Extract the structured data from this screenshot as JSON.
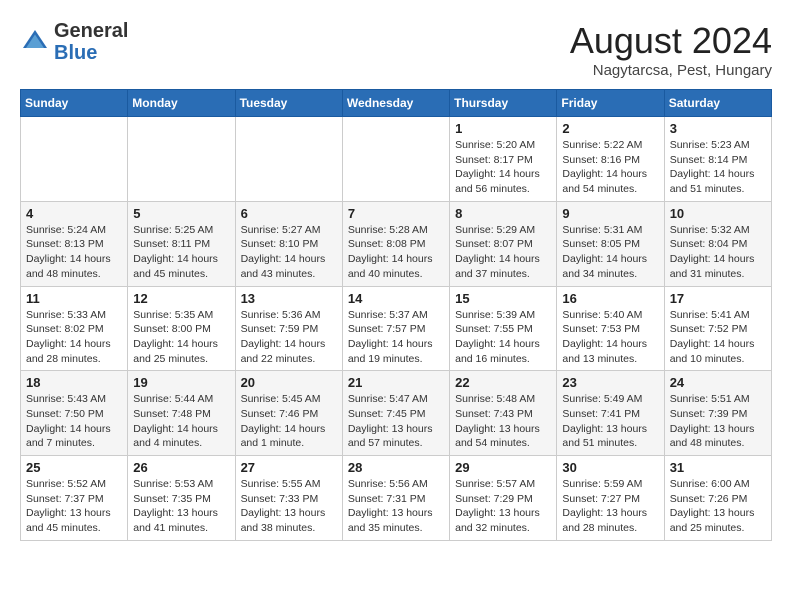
{
  "header": {
    "logo_general": "General",
    "logo_blue": "Blue",
    "month_title": "August 2024",
    "location": "Nagytarcsa, Pest, Hungary"
  },
  "weekdays": [
    "Sunday",
    "Monday",
    "Tuesday",
    "Wednesday",
    "Thursday",
    "Friday",
    "Saturday"
  ],
  "weeks": [
    [
      {
        "day": "",
        "info": ""
      },
      {
        "day": "",
        "info": ""
      },
      {
        "day": "",
        "info": ""
      },
      {
        "day": "",
        "info": ""
      },
      {
        "day": "1",
        "info": "Sunrise: 5:20 AM\nSunset: 8:17 PM\nDaylight: 14 hours\nand 56 minutes."
      },
      {
        "day": "2",
        "info": "Sunrise: 5:22 AM\nSunset: 8:16 PM\nDaylight: 14 hours\nand 54 minutes."
      },
      {
        "day": "3",
        "info": "Sunrise: 5:23 AM\nSunset: 8:14 PM\nDaylight: 14 hours\nand 51 minutes."
      }
    ],
    [
      {
        "day": "4",
        "info": "Sunrise: 5:24 AM\nSunset: 8:13 PM\nDaylight: 14 hours\nand 48 minutes."
      },
      {
        "day": "5",
        "info": "Sunrise: 5:25 AM\nSunset: 8:11 PM\nDaylight: 14 hours\nand 45 minutes."
      },
      {
        "day": "6",
        "info": "Sunrise: 5:27 AM\nSunset: 8:10 PM\nDaylight: 14 hours\nand 43 minutes."
      },
      {
        "day": "7",
        "info": "Sunrise: 5:28 AM\nSunset: 8:08 PM\nDaylight: 14 hours\nand 40 minutes."
      },
      {
        "day": "8",
        "info": "Sunrise: 5:29 AM\nSunset: 8:07 PM\nDaylight: 14 hours\nand 37 minutes."
      },
      {
        "day": "9",
        "info": "Sunrise: 5:31 AM\nSunset: 8:05 PM\nDaylight: 14 hours\nand 34 minutes."
      },
      {
        "day": "10",
        "info": "Sunrise: 5:32 AM\nSunset: 8:04 PM\nDaylight: 14 hours\nand 31 minutes."
      }
    ],
    [
      {
        "day": "11",
        "info": "Sunrise: 5:33 AM\nSunset: 8:02 PM\nDaylight: 14 hours\nand 28 minutes."
      },
      {
        "day": "12",
        "info": "Sunrise: 5:35 AM\nSunset: 8:00 PM\nDaylight: 14 hours\nand 25 minutes."
      },
      {
        "day": "13",
        "info": "Sunrise: 5:36 AM\nSunset: 7:59 PM\nDaylight: 14 hours\nand 22 minutes."
      },
      {
        "day": "14",
        "info": "Sunrise: 5:37 AM\nSunset: 7:57 PM\nDaylight: 14 hours\nand 19 minutes."
      },
      {
        "day": "15",
        "info": "Sunrise: 5:39 AM\nSunset: 7:55 PM\nDaylight: 14 hours\nand 16 minutes."
      },
      {
        "day": "16",
        "info": "Sunrise: 5:40 AM\nSunset: 7:53 PM\nDaylight: 14 hours\nand 13 minutes."
      },
      {
        "day": "17",
        "info": "Sunrise: 5:41 AM\nSunset: 7:52 PM\nDaylight: 14 hours\nand 10 minutes."
      }
    ],
    [
      {
        "day": "18",
        "info": "Sunrise: 5:43 AM\nSunset: 7:50 PM\nDaylight: 14 hours\nand 7 minutes."
      },
      {
        "day": "19",
        "info": "Sunrise: 5:44 AM\nSunset: 7:48 PM\nDaylight: 14 hours\nand 4 minutes."
      },
      {
        "day": "20",
        "info": "Sunrise: 5:45 AM\nSunset: 7:46 PM\nDaylight: 14 hours\nand 1 minute."
      },
      {
        "day": "21",
        "info": "Sunrise: 5:47 AM\nSunset: 7:45 PM\nDaylight: 13 hours\nand 57 minutes."
      },
      {
        "day": "22",
        "info": "Sunrise: 5:48 AM\nSunset: 7:43 PM\nDaylight: 13 hours\nand 54 minutes."
      },
      {
        "day": "23",
        "info": "Sunrise: 5:49 AM\nSunset: 7:41 PM\nDaylight: 13 hours\nand 51 minutes."
      },
      {
        "day": "24",
        "info": "Sunrise: 5:51 AM\nSunset: 7:39 PM\nDaylight: 13 hours\nand 48 minutes."
      }
    ],
    [
      {
        "day": "25",
        "info": "Sunrise: 5:52 AM\nSunset: 7:37 PM\nDaylight: 13 hours\nand 45 minutes."
      },
      {
        "day": "26",
        "info": "Sunrise: 5:53 AM\nSunset: 7:35 PM\nDaylight: 13 hours\nand 41 minutes."
      },
      {
        "day": "27",
        "info": "Sunrise: 5:55 AM\nSunset: 7:33 PM\nDaylight: 13 hours\nand 38 minutes."
      },
      {
        "day": "28",
        "info": "Sunrise: 5:56 AM\nSunset: 7:31 PM\nDaylight: 13 hours\nand 35 minutes."
      },
      {
        "day": "29",
        "info": "Sunrise: 5:57 AM\nSunset: 7:29 PM\nDaylight: 13 hours\nand 32 minutes."
      },
      {
        "day": "30",
        "info": "Sunrise: 5:59 AM\nSunset: 7:27 PM\nDaylight: 13 hours\nand 28 minutes."
      },
      {
        "day": "31",
        "info": "Sunrise: 6:00 AM\nSunset: 7:26 PM\nDaylight: 13 hours\nand 25 minutes."
      }
    ]
  ]
}
